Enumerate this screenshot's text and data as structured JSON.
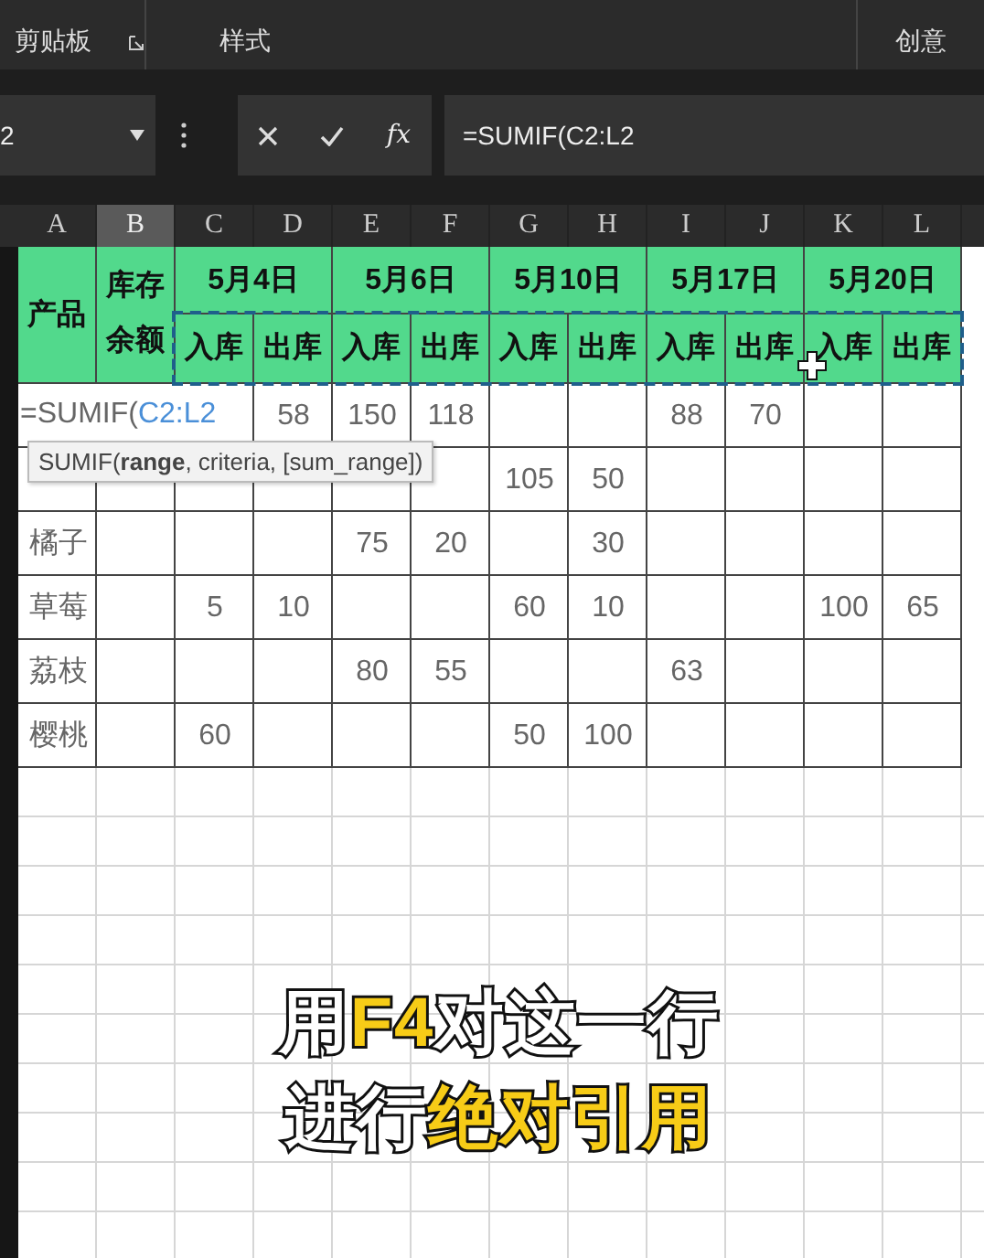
{
  "ribbon": {
    "groups": [
      {
        "label": "剪贴板",
        "launcher": true
      },
      {
        "label": "样式",
        "launcher": false
      },
      {
        "label": "创意",
        "launcher": false
      }
    ]
  },
  "formula_bar": {
    "name_box": "2",
    "function_label": "fx",
    "formula": "=SUMIF(C2:L2"
  },
  "columns": [
    {
      "label": "A",
      "selected": false
    },
    {
      "label": "B",
      "selected": true
    },
    {
      "label": "C",
      "selected": false
    },
    {
      "label": "D",
      "selected": false
    },
    {
      "label": "E",
      "selected": false
    },
    {
      "label": "F",
      "selected": false
    },
    {
      "label": "G",
      "selected": false
    },
    {
      "label": "H",
      "selected": false
    },
    {
      "label": "I",
      "selected": false
    },
    {
      "label": "J",
      "selected": false
    },
    {
      "label": "K",
      "selected": false
    },
    {
      "label": "L",
      "selected": false
    }
  ],
  "header": {
    "product": "产品",
    "balance": "库存余额",
    "dates": [
      "5月4日",
      "5月6日",
      "5月10日",
      "5月17日",
      "5月20日"
    ],
    "subheaders": [
      "入库",
      "出库",
      "入库",
      "出库",
      "入库",
      "出库",
      "入库",
      "出库",
      "入库",
      "出库"
    ],
    "marquee": true
  },
  "rows": [
    {
      "kind": "editing",
      "edit_text": "=SUMIF(",
      "edit_ref": "C2:L2",
      "cells": [
        null,
        null,
        null,
        "58",
        "150",
        "118",
        null,
        null,
        "88",
        "70",
        null,
        null
      ]
    },
    {
      "kind": "normal",
      "tooltip": "SUMIF(**range**, criteria, [sum_range])",
      "cells": [
        null,
        null,
        null,
        null,
        null,
        null,
        "105",
        "50",
        null,
        null,
        null,
        null
      ]
    },
    {
      "kind": "normal",
      "cells": [
        "橘子",
        null,
        null,
        null,
        "75",
        "20",
        null,
        "30",
        null,
        null,
        null,
        null
      ]
    },
    {
      "kind": "normal",
      "cells": [
        "草莓",
        null,
        "5",
        "10",
        null,
        null,
        "60",
        "10",
        null,
        null,
        "100",
        "65"
      ]
    },
    {
      "kind": "normal",
      "cells": [
        "荔枝",
        null,
        null,
        null,
        "80",
        "55",
        null,
        null,
        "63",
        null,
        null,
        null
      ]
    },
    {
      "kind": "normal",
      "cells": [
        "樱桃",
        null,
        "60",
        null,
        null,
        null,
        "50",
        "100",
        null,
        null,
        null,
        null
      ]
    }
  ],
  "caption": {
    "lines": [
      [
        {
          "text": "用",
          "highlight": false
        },
        {
          "text": "F4",
          "highlight": true
        },
        {
          "text": "对这一行",
          "highlight": false
        }
      ],
      [
        {
          "text": "进行",
          "highlight": false
        },
        {
          "text": "绝对引用",
          "highlight": true
        }
      ]
    ]
  }
}
